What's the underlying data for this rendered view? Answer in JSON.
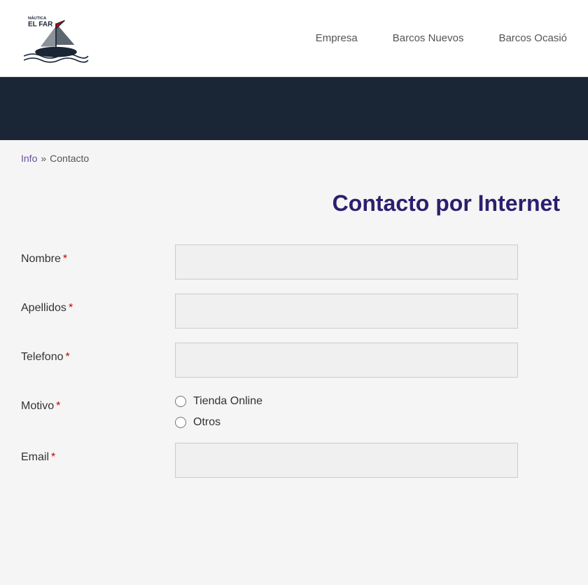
{
  "header": {
    "logo_text_line1": "NÁUTICA",
    "logo_text_line2": "EL FAR"
  },
  "nav": {
    "items": [
      {
        "label": "Empresa"
      },
      {
        "label": "Barcos Nuevos"
      },
      {
        "label": "Barcos Ocasió"
      }
    ]
  },
  "breadcrumb": {
    "info_label": "Info",
    "separator": "»",
    "current_label": "Contacto"
  },
  "page_title": "Contacto por Internet",
  "form": {
    "nombre_label": "Nombre",
    "apellidos_label": "Apellidos",
    "telefono_label": "Telefono",
    "motivo_label": "Motivo",
    "email_label": "Email",
    "required_marker": "*",
    "motivo_options": [
      {
        "value": "tienda_online",
        "label": "Tienda Online"
      },
      {
        "value": "otros",
        "label": "Otros"
      }
    ]
  },
  "colors": {
    "title_color": "#2c1f6e",
    "required_color": "#cc0000",
    "breadcrumb_link_color": "#6b4fa0",
    "dark_banner": "#1a2535"
  }
}
